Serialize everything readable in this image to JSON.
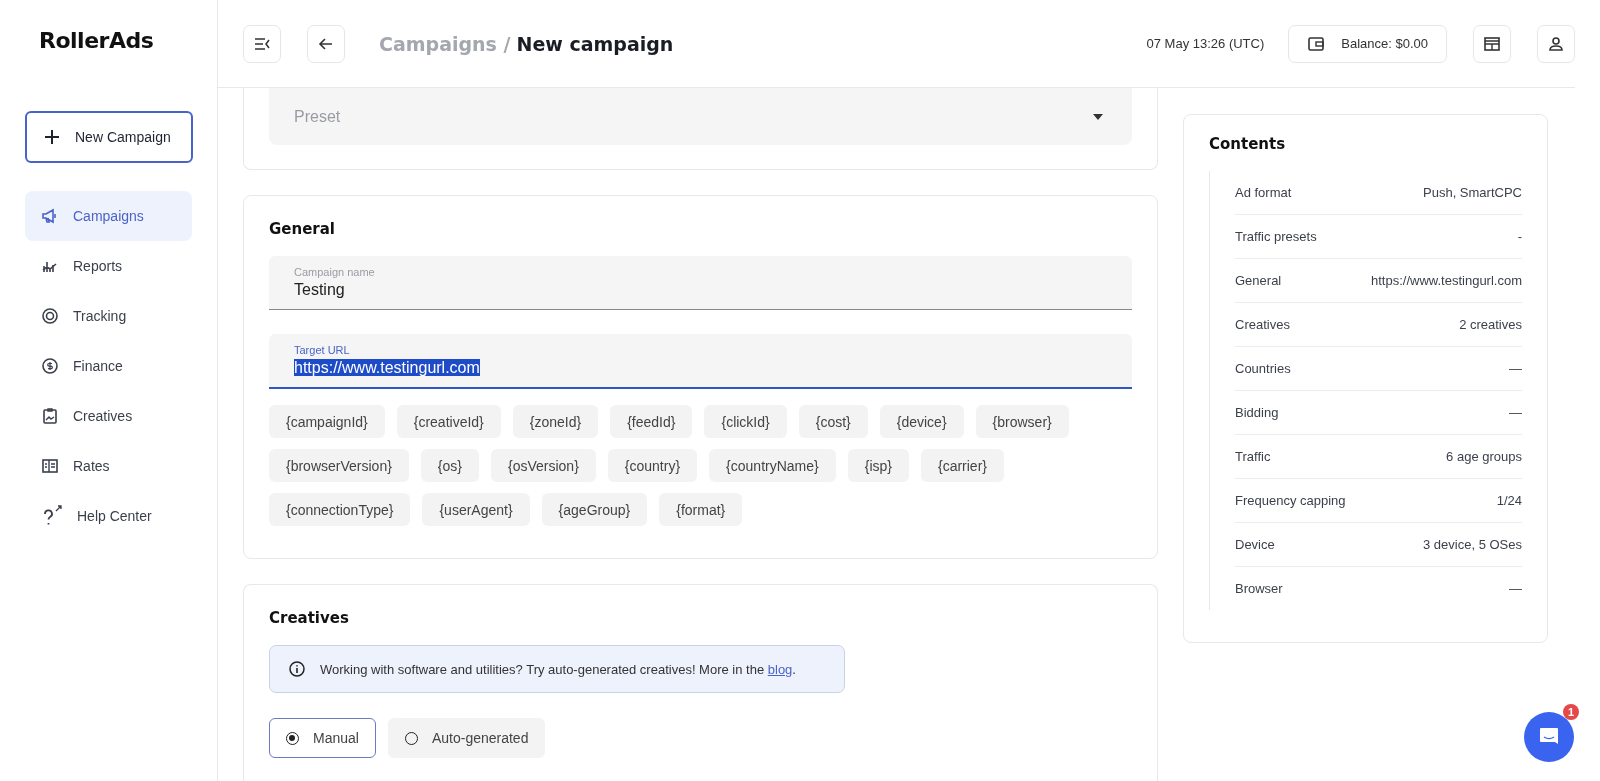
{
  "logo": "RollerAds",
  "sidebar": {
    "new_button": "New Campaign",
    "items": [
      {
        "label": "Campaigns",
        "kind": "megaphone",
        "selected": true
      },
      {
        "label": "Reports",
        "kind": "chart",
        "selected": false
      },
      {
        "label": "Tracking",
        "kind": "target",
        "selected": false
      },
      {
        "label": "Finance",
        "kind": "dollar",
        "selected": false
      },
      {
        "label": "Creatives",
        "kind": "clipboard",
        "selected": false
      },
      {
        "label": "Rates",
        "kind": "rates",
        "selected": false
      },
      {
        "label": "Help Center",
        "kind": "help",
        "selected": false
      }
    ]
  },
  "header": {
    "breadcrumb_parent": "Campaigns /",
    "title": "New campaign",
    "time": "07 May 13:26 (UTC)",
    "balance": "Balance: $0.00"
  },
  "preset": {
    "placeholder": "Preset"
  },
  "general": {
    "title": "General",
    "fields": [
      {
        "label": "Campaign name",
        "value": "Testing",
        "focused": false
      },
      {
        "label": "Target URL",
        "value": "https://www.testingurl.com",
        "focused": true
      }
    ],
    "macros": [
      "{campaignId}",
      "{creativeId}",
      "{zoneId}",
      "{feedId}",
      "{clickId}",
      "{cost}",
      "{device}",
      "{browser}",
      "{browserVersion}",
      "{os}",
      "{osVersion}",
      "{country}",
      "{countryName}",
      "{isp}",
      "{carrier}",
      "{connectionType}",
      "{userAgent}",
      "{ageGroup}",
      "{format}"
    ]
  },
  "creatives": {
    "title": "Creatives",
    "info": "Working with software and utilities? Try auto-generated creatives! More in the ",
    "info_link": "blog",
    "info_end": ".",
    "modes": [
      {
        "label": "Manual",
        "selected": true
      },
      {
        "label": "Auto-generated",
        "selected": false
      }
    ]
  },
  "contents": {
    "title": "Contents",
    "rows": [
      {
        "label": "Ad format",
        "value": "Push, SmartCPC"
      },
      {
        "label": "Traffic presets",
        "value": "-"
      },
      {
        "label": "General",
        "value": "https://www.testingurl.com"
      },
      {
        "label": "Creatives",
        "value": "2 creatives"
      },
      {
        "label": "Countries",
        "value": "—"
      },
      {
        "label": "Bidding",
        "value": "—"
      },
      {
        "label": "Traffic",
        "value": "6 age groups"
      },
      {
        "label": "Frequency capping",
        "value": "1/24"
      },
      {
        "label": "Device",
        "value": "3 device, 5 OSes"
      },
      {
        "label": "Browser",
        "value": "—"
      }
    ]
  },
  "chat": {
    "badge": "1"
  }
}
